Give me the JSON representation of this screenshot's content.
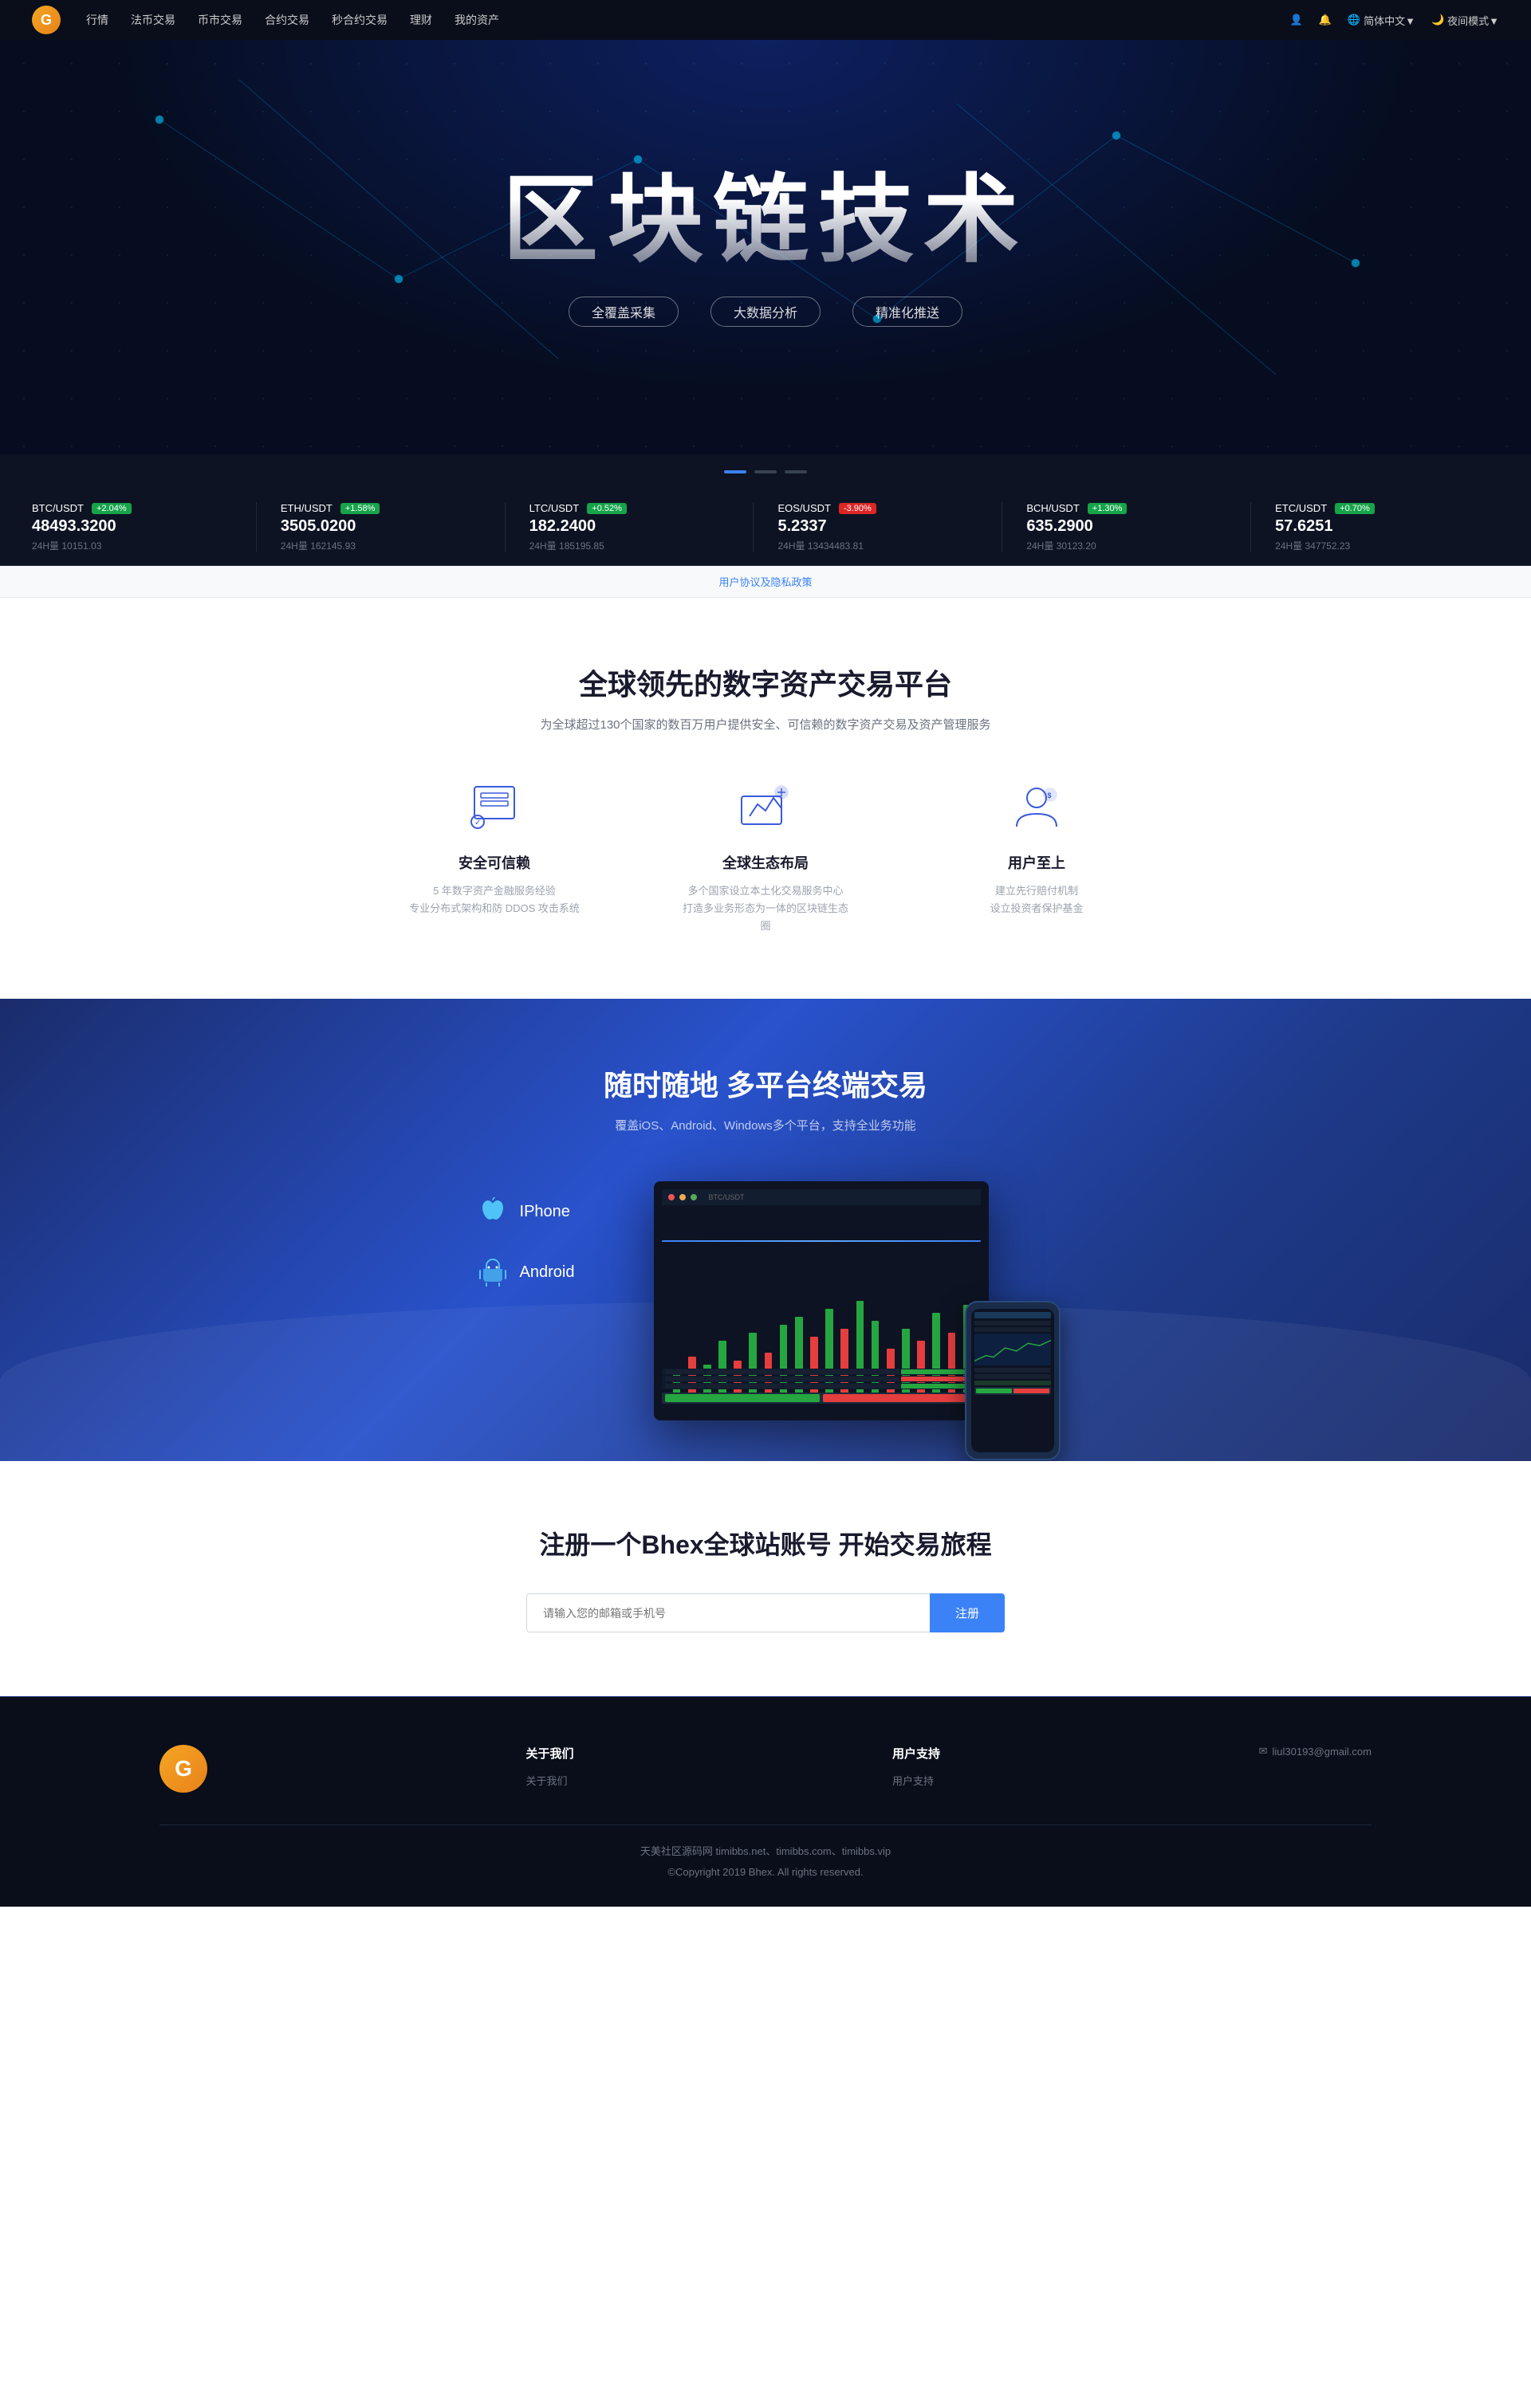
{
  "navbar": {
    "logo_char": "G",
    "menu_items": [
      "行情",
      "法币交易",
      "币市交易",
      "合约交易",
      "秒合约交易",
      "理财",
      "我的资产"
    ],
    "right_items": [
      "用户图标",
      "铃铛"
    ],
    "lang_label": "简体中文▼",
    "night_label": "夜间模式▼"
  },
  "hero": {
    "title": "区块链技术",
    "subtitle_items": [
      "全覆盖采集",
      "大数据分析",
      "精准化推送"
    ]
  },
  "ticker": {
    "items": [
      {
        "pair": "BTC/USDT",
        "change": "+2.04%",
        "change_type": "green",
        "price": "48493.3200",
        "vol_label": "24H量",
        "vol": "10151.03"
      },
      {
        "pair": "ETH/USDT",
        "change": "+1.58%",
        "change_type": "green",
        "price": "3505.0200",
        "vol_label": "24H量",
        "vol": "162145.93"
      },
      {
        "pair": "LTC/USDT",
        "change": "+0.52%",
        "change_type": "green",
        "price": "182.2400",
        "vol_label": "24H量",
        "vol": "185195.85"
      },
      {
        "pair": "EOS/USDT",
        "change": "-3.90%",
        "change_type": "red",
        "price": "5.2337",
        "vol_label": "24H量",
        "vol": "13434483.81"
      },
      {
        "pair": "BCH/USDT",
        "change": "+1.30%",
        "change_type": "green",
        "price": "635.2900",
        "vol_label": "24H量",
        "vol": "30123.20"
      },
      {
        "pair": "ETC/USDT",
        "change": "+0.70%",
        "change_type": "green",
        "price": "57.6251",
        "vol_label": "24H量",
        "vol": "347752.23"
      }
    ]
  },
  "agreement": {
    "text": "用户协议及隐私政策"
  },
  "platform": {
    "title": "全球领先的数字资产交易平台",
    "subtitle": "为全球超过130个国家的数百万用户提供安全、可信赖的数字资产交易及资产管理服务",
    "features": [
      {
        "id": "security",
        "title": "安全可信赖",
        "desc_lines": [
          "5 年数字资产金融服务经验",
          "专业分布式架构和防 DDOS 攻击系统"
        ]
      },
      {
        "id": "global",
        "title": "全球生态布局",
        "desc_lines": [
          "多个国家设立本土化交易服务中心",
          "打造多业务形态为一体的区块链生态圈"
        ]
      },
      {
        "id": "user",
        "title": "用户至上",
        "desc_lines": [
          "建立先行赔付机制",
          "设立投资者保护基金"
        ]
      }
    ]
  },
  "multiplatform": {
    "title": "随时随地 多平台终端交易",
    "subtitle": "覆盖iOS、Android、Windows多个平台，支持全业务功能",
    "links": [
      {
        "id": "iphone",
        "label": "IPhone",
        "icon": "apple"
      },
      {
        "id": "android",
        "label": "Android",
        "icon": "android"
      }
    ]
  },
  "register": {
    "title": "注册一个Bhex全球站账号 开始交易旅程",
    "input_placeholder": "请输入您的邮箱或手机号",
    "button_label": "注册"
  },
  "footer": {
    "logo_char": "G",
    "nav_groups": [
      {
        "title": "关于我们",
        "items": [
          "关于我们"
        ]
      },
      {
        "title": "用户支持",
        "items": [
          "用户支持"
        ]
      }
    ],
    "contact_email": "✉ liul30193@gmail.com",
    "bottom_lines": [
      "天美社区源码网 timibbs.net、timibbs.com、timibbs.vip",
      "©Copyright 2019 Bhex. All rights reserved."
    ]
  },
  "carousel": {
    "dots": [
      "active",
      "inactive",
      "inactive"
    ]
  },
  "candles": [
    {
      "type": "up",
      "h": 30
    },
    {
      "type": "down",
      "h": 50
    },
    {
      "type": "up",
      "h": 40
    },
    {
      "type": "up",
      "h": 70
    },
    {
      "type": "down",
      "h": 45
    },
    {
      "type": "up",
      "h": 80
    },
    {
      "type": "down",
      "h": 55
    },
    {
      "type": "up",
      "h": 90
    },
    {
      "type": "up",
      "h": 100
    },
    {
      "type": "down",
      "h": 75
    },
    {
      "type": "up",
      "h": 110
    },
    {
      "type": "down",
      "h": 85
    },
    {
      "type": "up",
      "h": 120
    },
    {
      "type": "up",
      "h": 95
    },
    {
      "type": "down",
      "h": 60
    },
    {
      "type": "up",
      "h": 85
    },
    {
      "type": "down",
      "h": 70
    },
    {
      "type": "up",
      "h": 105
    },
    {
      "type": "down",
      "h": 80
    },
    {
      "type": "up",
      "h": 115
    }
  ]
}
